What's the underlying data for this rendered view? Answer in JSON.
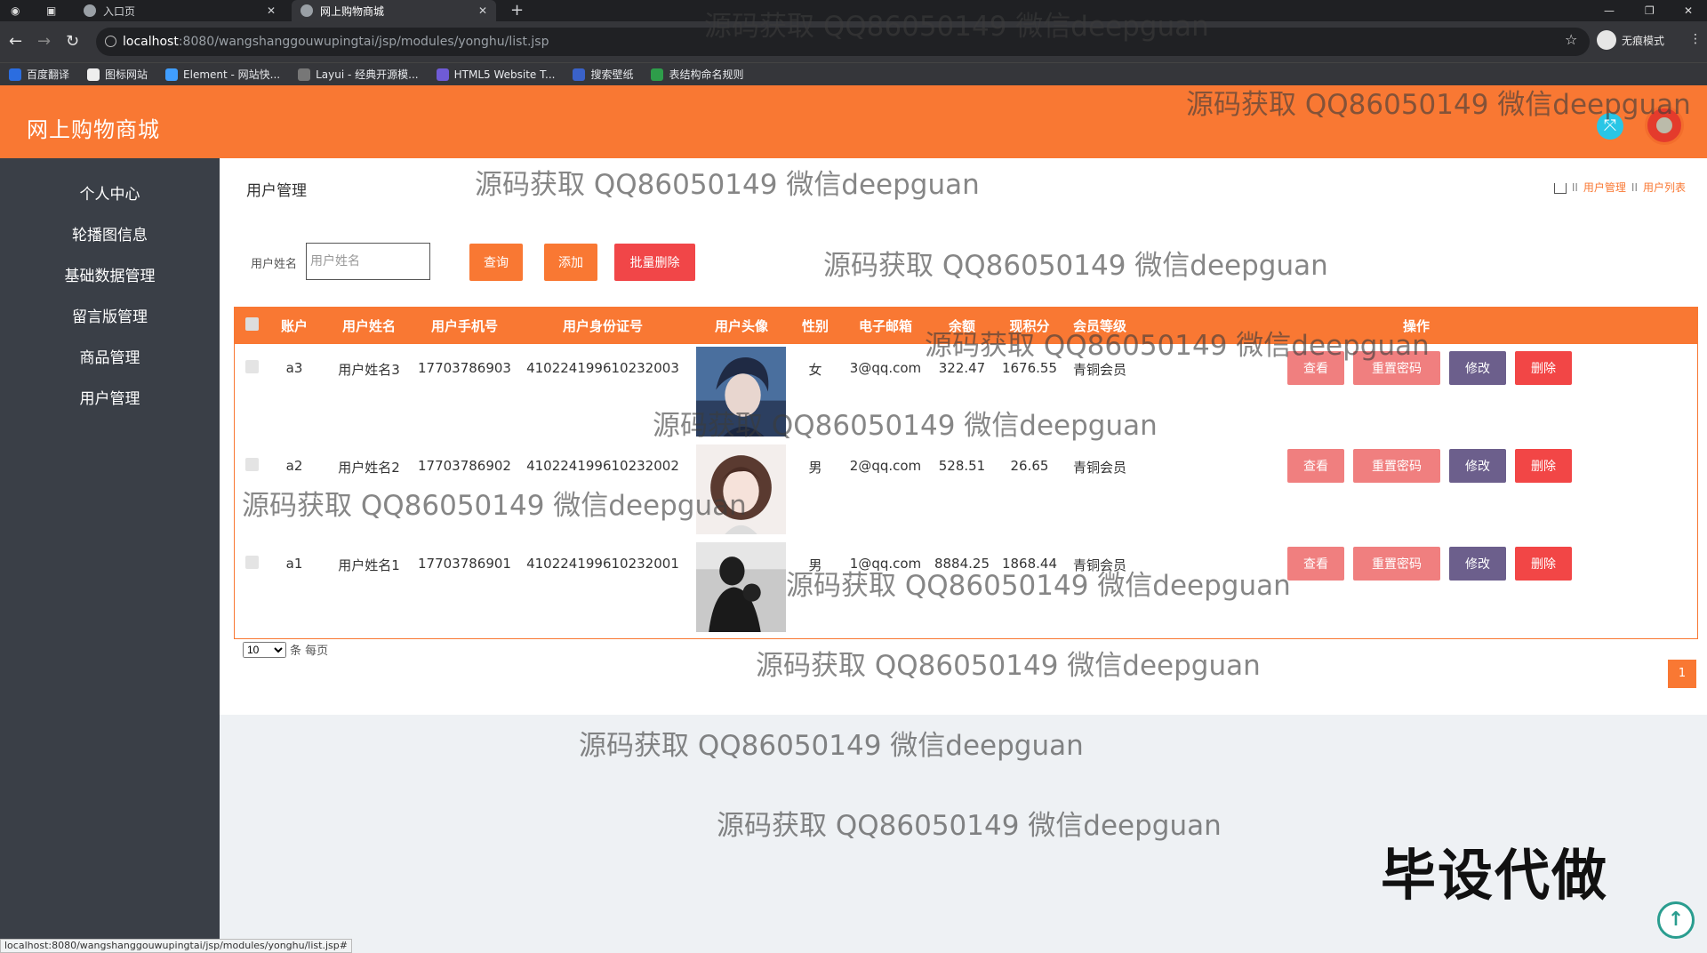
{
  "browser": {
    "tabs": [
      {
        "title": "入口页"
      },
      {
        "title": "网上购物商城"
      }
    ],
    "url_host": "localhost",
    "url_path": ":8080/wangshanggouwupingtai/jsp/modules/yonghu/list.jsp",
    "incognito_label": "无痕模式",
    "bookmarks": [
      "百度翻译",
      "图标网站",
      "Element - 网站快...",
      "Layui - 经典开源模...",
      "HTML5 Website T...",
      "搜索壁纸",
      "表结构命名规则"
    ],
    "status_url": "localhost:8080/wangshanggouwupingtai/jsp/modules/yonghu/list.jsp#"
  },
  "app": {
    "title": "网上购物商城"
  },
  "sidebar": {
    "items": [
      {
        "label": "个人中心"
      },
      {
        "label": "轮播图信息"
      },
      {
        "label": "基础数据管理"
      },
      {
        "label": "留言版管理"
      },
      {
        "label": "商品管理"
      },
      {
        "label": "用户管理"
      }
    ]
  },
  "page": {
    "title": "用户管理",
    "breadcrumb": [
      "用户管理",
      "用户列表"
    ],
    "breadcrumb_sep": "II"
  },
  "search": {
    "label": "用户姓名",
    "placeholder": "用户姓名",
    "query_btn": "查询",
    "add_btn": "添加",
    "batch_delete_btn": "批量删除"
  },
  "table": {
    "headers": [
      "账户",
      "用户姓名",
      "用户手机号",
      "用户身份证号",
      "用户头像",
      "性别",
      "电子邮箱",
      "余额",
      "现积分",
      "会员等级",
      "操作"
    ],
    "rows": [
      {
        "account": "a3",
        "name": "用户姓名3",
        "phone": "17703786903",
        "idcard": "410224199610232003",
        "gender": "女",
        "email": "3@qq.com",
        "balance": "322.47",
        "points": "1676.55",
        "level": "青铜会员"
      },
      {
        "account": "a2",
        "name": "用户姓名2",
        "phone": "17703786902",
        "idcard": "410224199610232002",
        "gender": "男",
        "email": "2@qq.com",
        "balance": "528.51",
        "points": "26.65",
        "level": "青铜会员"
      },
      {
        "account": "a1",
        "name": "用户姓名1",
        "phone": "17703786901",
        "idcard": "410224199610232001",
        "gender": "男",
        "email": "1@qq.com",
        "balance": "8884.25",
        "points": "1868.44",
        "level": "青铜会员"
      }
    ],
    "actions": {
      "view": "查看",
      "reset_pwd": "重置密码",
      "edit": "修改",
      "delete": "删除"
    }
  },
  "pagination": {
    "page_size": "10",
    "page_size_suffix": "条 每页",
    "current_page": "1"
  },
  "overlay": {
    "watermark": "源码获取 QQ86050149 微信deepguan",
    "big_text": "毕设代做"
  },
  "colors": {
    "accent": "#f97833",
    "sidebar": "#3a3f47",
    "danger": "#f24646",
    "edit": "#6c5f8c"
  }
}
